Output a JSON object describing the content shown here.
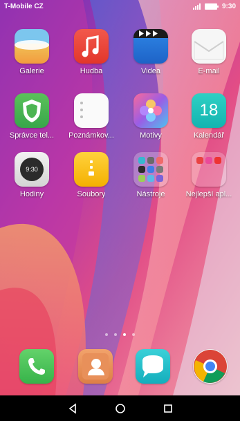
{
  "status_bar": {
    "carrier": "T-Mobile CZ",
    "time": "9:30"
  },
  "apps": [
    {
      "label": "Galerie",
      "icon": "gallery-icon"
    },
    {
      "label": "Hudba",
      "icon": "music-icon"
    },
    {
      "label": "Videa",
      "icon": "video-icon"
    },
    {
      "label": "E-mail",
      "icon": "email-icon"
    },
    {
      "label": "Správce tel...",
      "icon": "phone-manager-icon"
    },
    {
      "label": "Poznámkov...",
      "icon": "notepad-icon"
    },
    {
      "label": "Motivy",
      "icon": "themes-icon"
    },
    {
      "label": "Kalendář",
      "icon": "calendar-icon",
      "day": "18"
    },
    {
      "label": "Hodiny",
      "icon": "clock-icon",
      "clock_time": "9:30"
    },
    {
      "label": "Soubory",
      "icon": "files-icon"
    },
    {
      "label": "Nástroje",
      "icon": "tools-folder-icon"
    },
    {
      "label": "Nejlepší apl...",
      "icon": "top-apps-folder-icon"
    }
  ],
  "dock": [
    {
      "icon": "phone-icon"
    },
    {
      "icon": "contacts-icon"
    },
    {
      "icon": "messages-icon"
    },
    {
      "icon": "chrome-icon"
    }
  ],
  "pager": {
    "pages": 4,
    "active": 3
  },
  "nav": {
    "back": "back-icon",
    "home": "home-icon",
    "recents": "recents-icon"
  }
}
